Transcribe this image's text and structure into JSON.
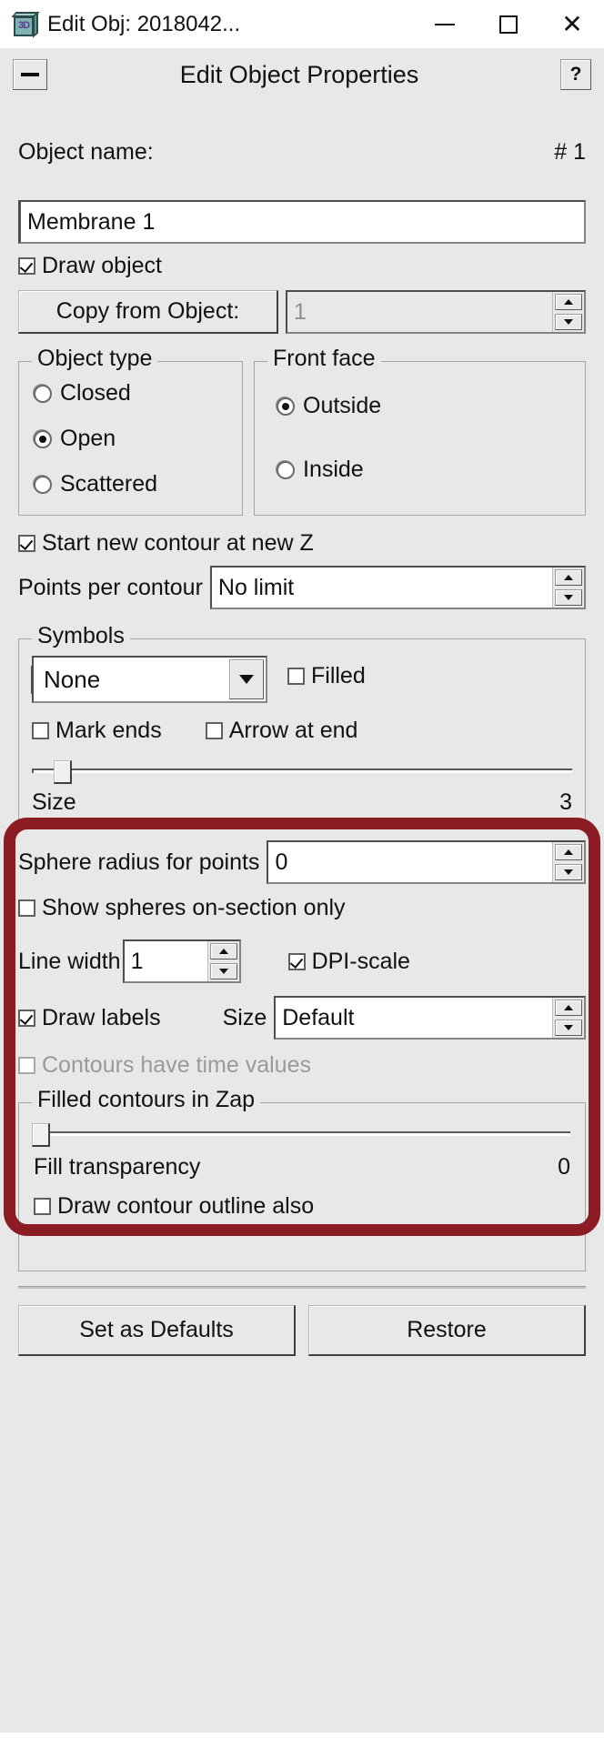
{
  "window": {
    "title": "Edit Obj: 2018042...",
    "icon": "cube-3d-icon",
    "icon_label": "3D",
    "minimize_label": "Minimize",
    "maximize_label": "Maximize",
    "close_label": "Close"
  },
  "header": {
    "collapse_label": "Collapse",
    "title": "Edit Object Properties",
    "help_label": "?"
  },
  "object": {
    "name_label": "Object name:",
    "number_label": "# 1",
    "name_value": "Membrane 1",
    "draw_object_label": "Draw object",
    "draw_object_checked": true,
    "copy_from_label": "Copy from Object:",
    "copy_from_value": "1"
  },
  "object_type": {
    "group_title": "Object type",
    "options": [
      "Closed",
      "Open",
      "Scattered"
    ],
    "selected": "Open"
  },
  "front_face": {
    "group_title": "Front face",
    "options": [
      "Outside",
      "Inside"
    ],
    "selected": "Outside"
  },
  "contour": {
    "start_new_label": "Start new contour at new Z",
    "start_new_checked": true,
    "points_per_contour_label": "Points per contour",
    "points_per_contour_value": "No limit"
  },
  "symbols": {
    "group_title": "Symbols",
    "type_value": "None",
    "filled_label": "Filled",
    "filled_checked": false,
    "mark_ends_label": "Mark ends",
    "mark_ends_checked": false,
    "arrow_at_end_label": "Arrow at end",
    "arrow_at_end_checked": false,
    "size_label": "Size",
    "size_value": "3",
    "size_slider_percent": 3
  },
  "spheres": {
    "radius_label": "Sphere radius for points",
    "radius_value": "0",
    "on_section_label": "Show spheres on-section only",
    "on_section_checked": false
  },
  "line": {
    "width_label": "Line width",
    "width_value": "1",
    "dpi_scale_label": "DPI-scale",
    "dpi_scale_checked": true
  },
  "labels": {
    "draw_labels_label": "Draw labels",
    "draw_labels_checked": true,
    "size_label": "Size",
    "size_value": "Default"
  },
  "time_values": {
    "label": "Contours have time values",
    "checked": false,
    "disabled": true
  },
  "filled_contours": {
    "group_title": "Filled contours in Zap",
    "transparency_label": "Fill transparency",
    "transparency_value": "0",
    "transparency_slider_percent": 0,
    "outline_label": "Draw contour outline also",
    "outline_checked": false
  },
  "footer": {
    "set_defaults_label": "Set as Defaults",
    "restore_label": "Restore"
  },
  "annotation": {
    "highlight_color": "#8c1c24",
    "highlight_target": "symbols-and-spheres-section"
  }
}
